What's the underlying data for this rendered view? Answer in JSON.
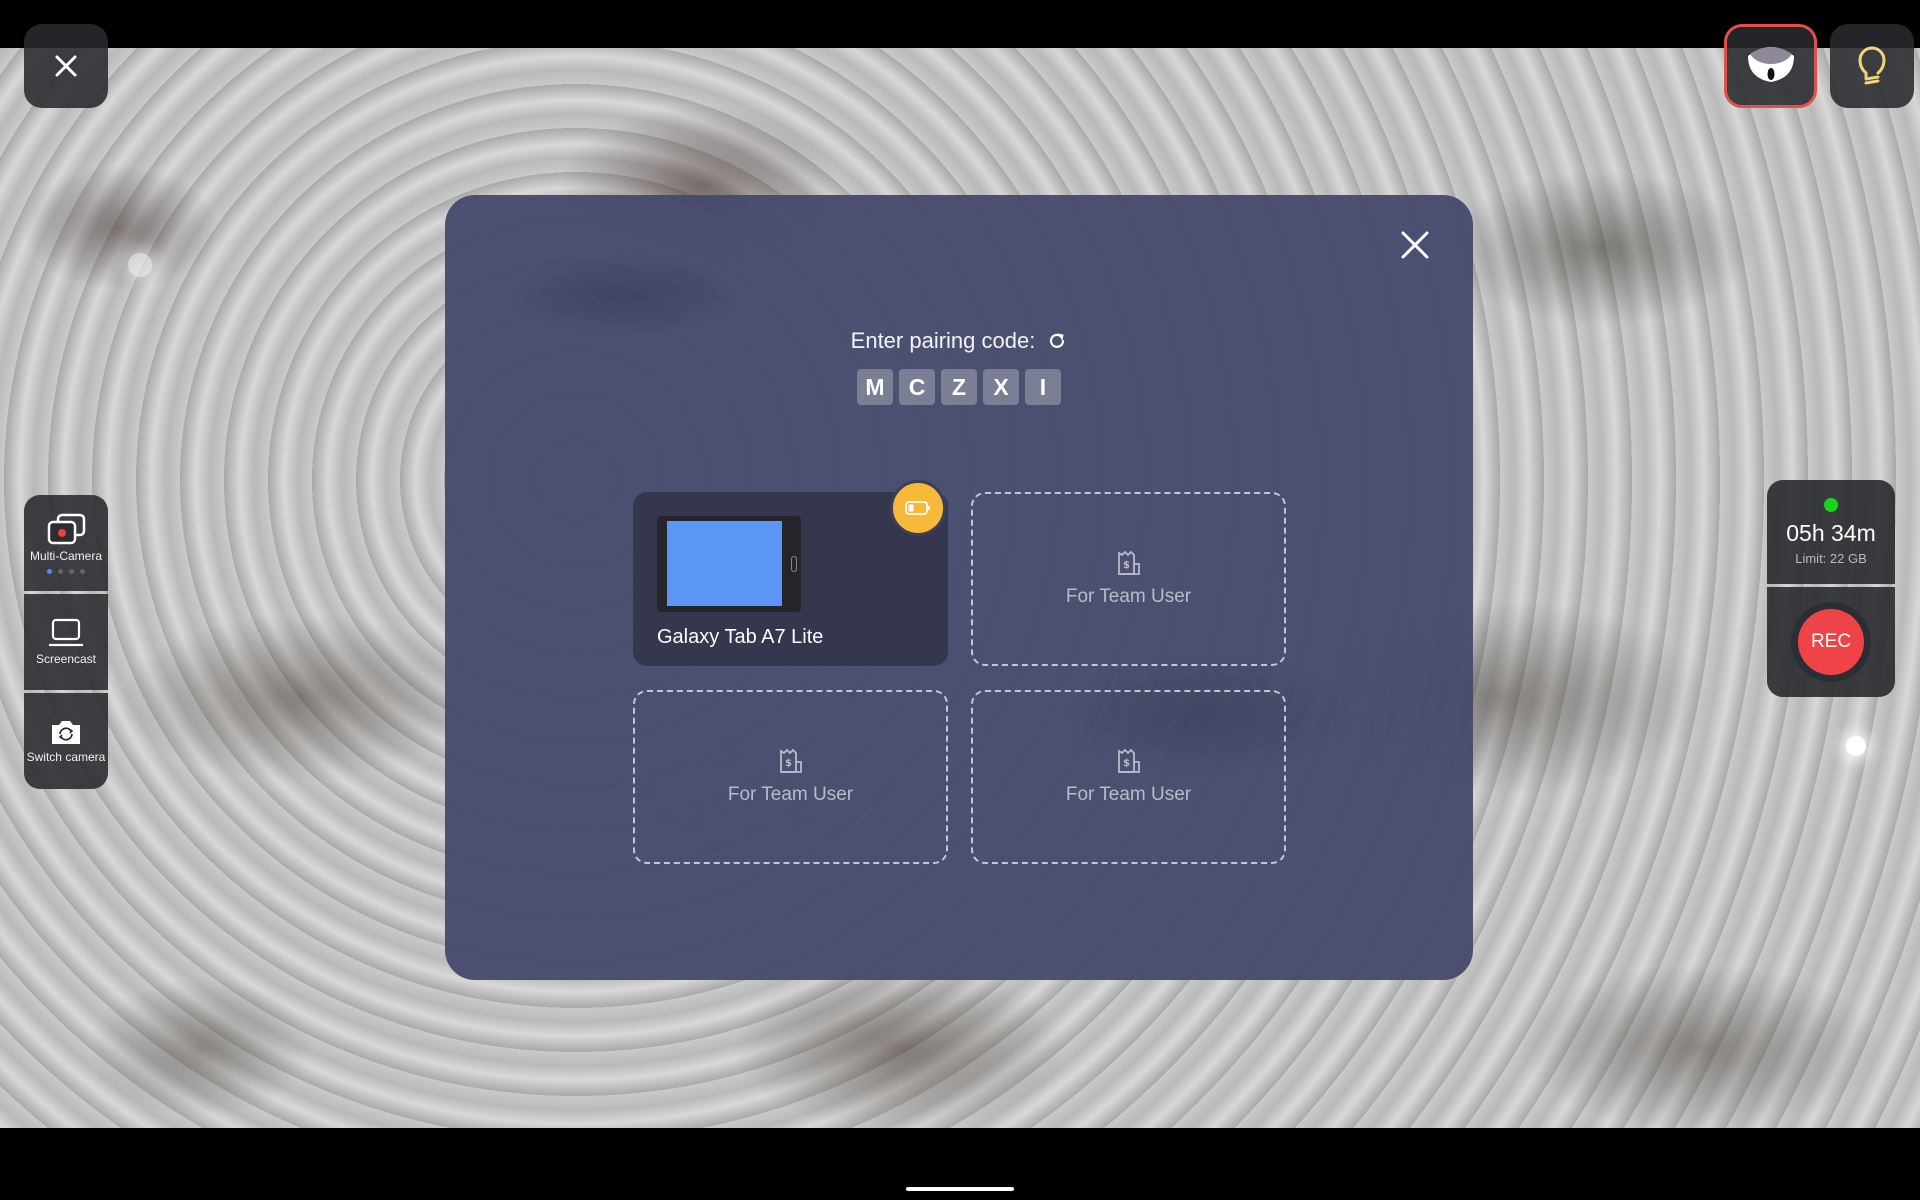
{
  "topbar": {
    "close_icon": "close-icon",
    "camera_device_icon": "camera-device-icon",
    "lightbulb_icon": "lightbulb-icon"
  },
  "left_toolbar": {
    "items": [
      {
        "label": "Multi-Camera",
        "icon": "multi-camera-icon",
        "page_count": 4,
        "active_page": 1
      },
      {
        "label": "Screencast",
        "icon": "laptop-icon"
      },
      {
        "label": "Switch camera",
        "icon": "switch-camera-icon"
      }
    ]
  },
  "right_panel": {
    "status_color": "#19d41a",
    "time_remaining": "05h 34m",
    "limit": "Limit: 22 GB",
    "rec_label": "REC",
    "rec_color": "#ee4447"
  },
  "modal": {
    "pairing_label": "Enter pairing code:",
    "refresh_icon": "refresh-icon",
    "code": [
      "M",
      "C",
      "Z",
      "X",
      "I"
    ],
    "slots": [
      {
        "type": "device",
        "name": "Galaxy Tab A7 Lite",
        "badge_icon": "battery-low-icon",
        "badge_color": "#f9b938"
      },
      {
        "type": "empty",
        "label": "For Team User",
        "icon": "receipt-dollar-icon"
      },
      {
        "type": "empty",
        "label": "For Team User",
        "icon": "receipt-dollar-icon"
      },
      {
        "type": "empty",
        "label": "For Team User",
        "icon": "receipt-dollar-icon"
      }
    ]
  }
}
